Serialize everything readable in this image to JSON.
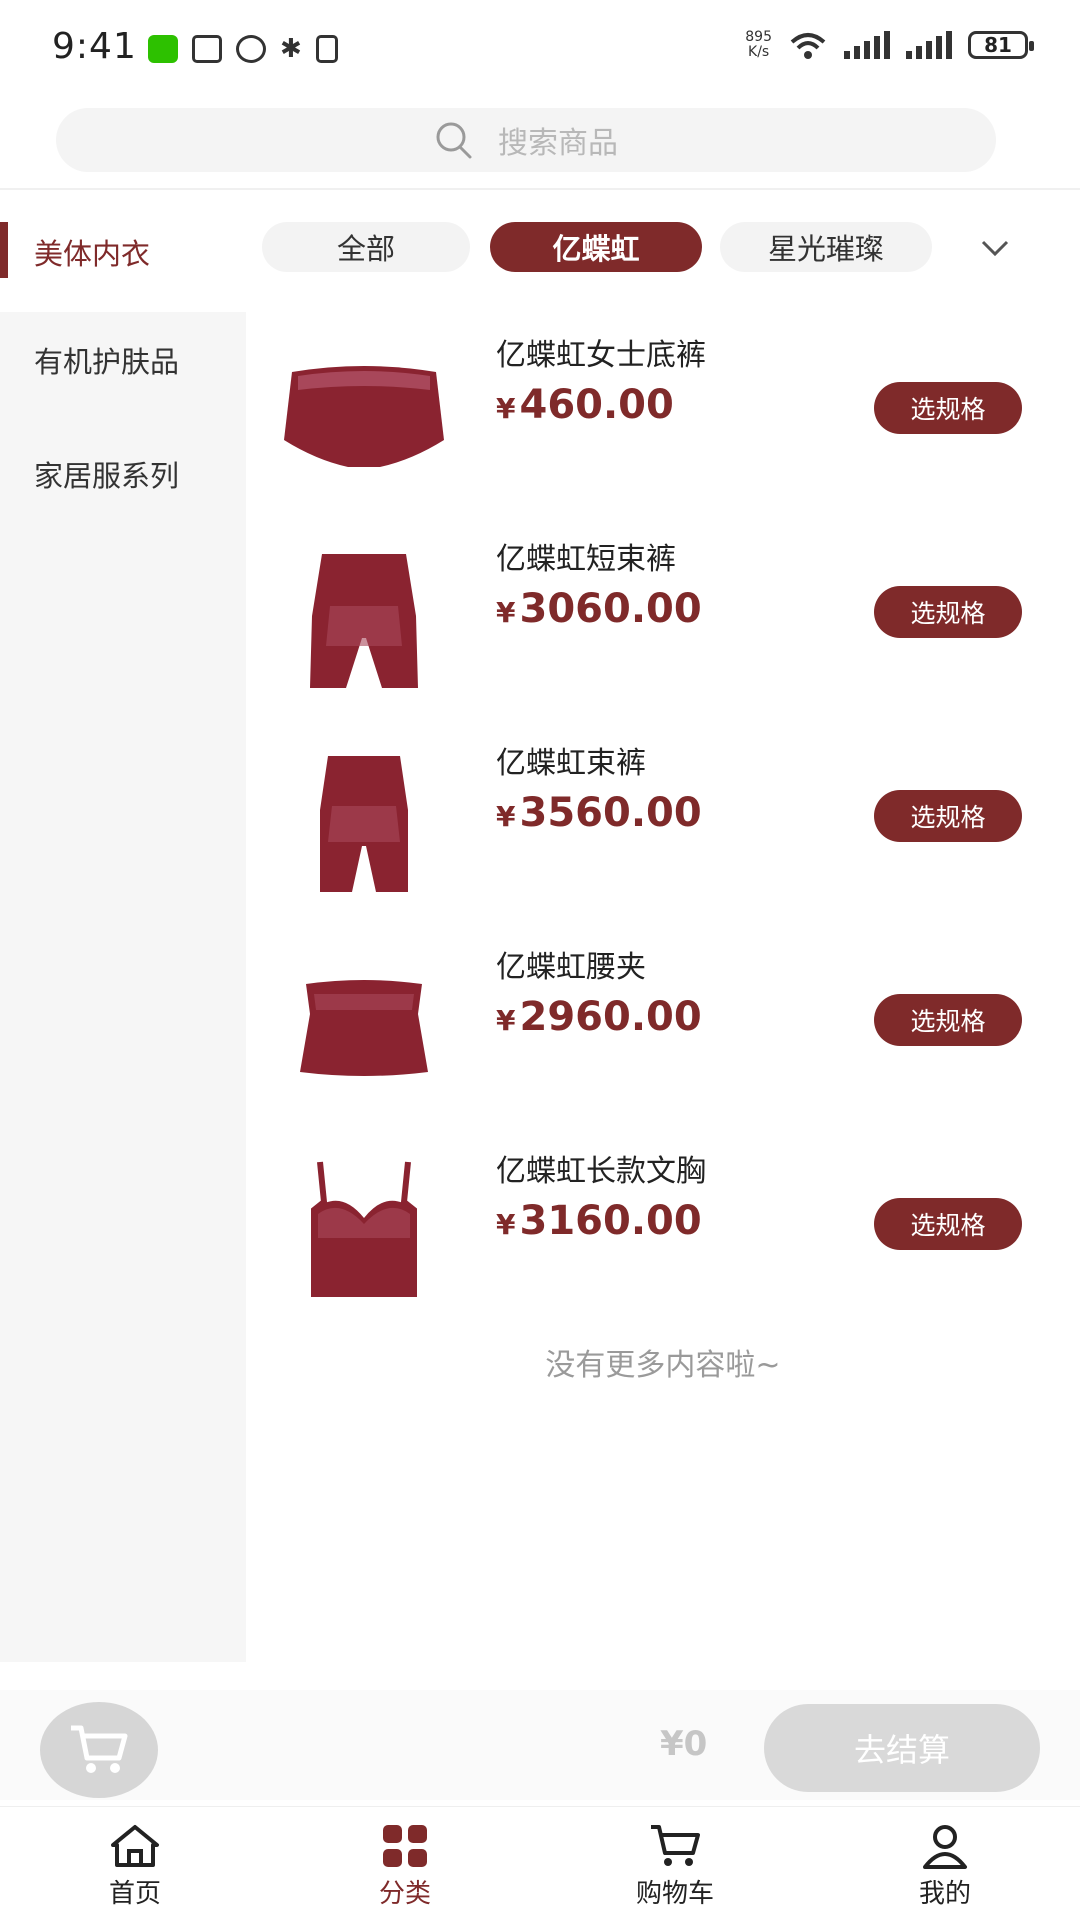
{
  "status_bar": {
    "time": "9:41",
    "net_speed_top": "895",
    "net_speed_bottom": "K/s",
    "battery": "81"
  },
  "search": {
    "placeholder": "搜索商品"
  },
  "sidebar": {
    "items": [
      {
        "label": "美体内衣",
        "active": true
      },
      {
        "label": "有机护肤品",
        "active": false
      },
      {
        "label": "家居服系列",
        "active": false
      }
    ]
  },
  "chips": [
    {
      "label": "全部",
      "active": false
    },
    {
      "label": "亿蝶虹",
      "active": true
    },
    {
      "label": "星光璀璨",
      "active": false
    }
  ],
  "currency_symbol": "¥",
  "products": [
    {
      "name": "亿蝶虹女士底裤",
      "price": "460.00",
      "button": "选规格",
      "icon": "briefs-icon"
    },
    {
      "name": "亿蝶虹短束裤",
      "price": "3060.00",
      "button": "选规格",
      "icon": "shaping-shorts-icon"
    },
    {
      "name": "亿蝶虹束裤",
      "price": "3560.00",
      "button": "选规格",
      "icon": "shaping-pants-icon"
    },
    {
      "name": "亿蝶虹腰夹",
      "price": "2960.00",
      "button": "选规格",
      "icon": "waist-cincher-icon"
    },
    {
      "name": "亿蝶虹长款文胸",
      "price": "3160.00",
      "button": "选规格",
      "icon": "longline-bra-icon"
    }
  ],
  "no_more_text": "没有更多内容啦~",
  "cart_bar": {
    "total": "¥0",
    "checkout_label": "去结算"
  },
  "bottom_nav": [
    {
      "label": "首页",
      "icon": "home-icon",
      "active": false
    },
    {
      "label": "分类",
      "icon": "category-icon",
      "active": true
    },
    {
      "label": "购物车",
      "icon": "cart-icon",
      "active": false
    },
    {
      "label": "我的",
      "icon": "profile-icon",
      "active": false
    }
  ],
  "colors": {
    "accent": "#7f2a2a",
    "product": "#8a2330",
    "disabled": "#d9d9d9"
  }
}
